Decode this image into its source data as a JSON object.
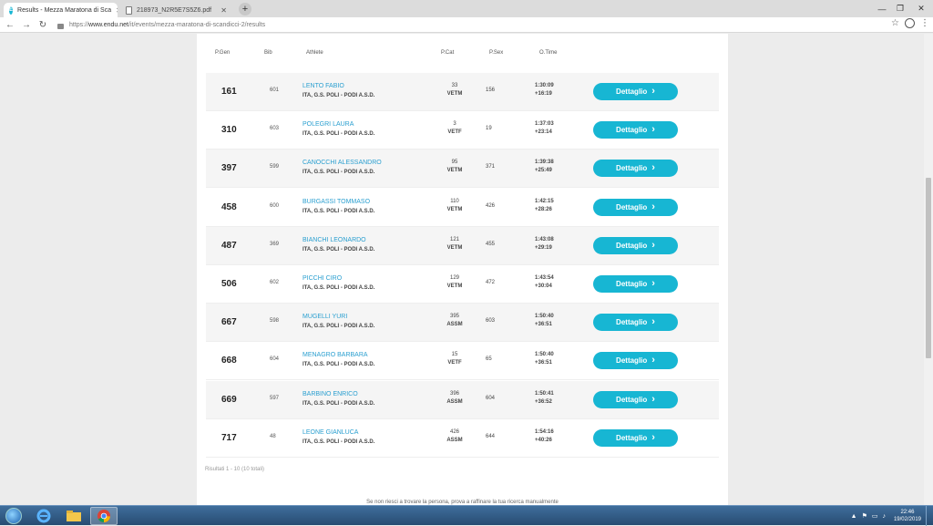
{
  "browser": {
    "tabs": [
      {
        "title": "Results - Mezza Maratona di Sca",
        "favicon": "E",
        "active": true
      },
      {
        "title": "218973_N2R5E7S5Z6.pdf",
        "active": false
      }
    ],
    "new_tab_glyph": "+",
    "address": {
      "scheme": "https://",
      "domain": "www.endu.net",
      "path": "/it/events/mezza-maratona-di-scandicci-2/results"
    }
  },
  "table": {
    "headers": {
      "pgen": "P.Gen",
      "bib": "Bib",
      "athlete": "Athlete",
      "pcat": "P.Cat",
      "psex": "P.Sex",
      "otime": "O.Time"
    },
    "detail_label": "Dettaglio",
    "rows": [
      {
        "pgen": "161",
        "bib": "601",
        "name": "LENTO FABIO",
        "club": "ITA, G.S. POLI - PODI A.S.D.",
        "pcat": "33",
        "cat": "VETM",
        "psex": "156",
        "time": "1:30:09",
        "gap": "+16:19"
      },
      {
        "pgen": "310",
        "bib": "603",
        "name": "POLEGRI LAURA",
        "club": "ITA, G.S. POLI - PODI A.S.D.",
        "pcat": "3",
        "cat": "VETF",
        "psex": "19",
        "time": "1:37:03",
        "gap": "+23:14"
      },
      {
        "pgen": "397",
        "bib": "599",
        "name": "CANOCCHI ALESSANDRO",
        "club": "ITA, G.S. POLI - PODI A.S.D.",
        "pcat": "95",
        "cat": "VETM",
        "psex": "371",
        "time": "1:39:38",
        "gap": "+25:49"
      },
      {
        "pgen": "458",
        "bib": "600",
        "name": "BURGASSI TOMMASO",
        "club": "ITA, G.S. POLI - PODI A.S.D.",
        "pcat": "110",
        "cat": "VETM",
        "psex": "426",
        "time": "1:42:15",
        "gap": "+28:26"
      },
      {
        "pgen": "487",
        "bib": "369",
        "name": "BIANCHI LEONARDO",
        "club": "ITA, G.S. POLI - PODI A.S.D.",
        "pcat": "121",
        "cat": "VETM",
        "psex": "455",
        "time": "1:43:08",
        "gap": "+29:19"
      },
      {
        "pgen": "506",
        "bib": "602",
        "name": "PICCHI CIRO",
        "club": "ITA, G.S. POLI - PODI A.S.D.",
        "pcat": "129",
        "cat": "VETM",
        "psex": "472",
        "time": "1:43:54",
        "gap": "+30:04"
      },
      {
        "pgen": "667",
        "bib": "598",
        "name": "MUGELLI YURI",
        "club": "ITA, G.S. POLI - PODI A.S.D.",
        "pcat": "395",
        "cat": "ASSM",
        "psex": "603",
        "time": "1:50:40",
        "gap": "+36:51"
      },
      {
        "pgen": "668",
        "bib": "604",
        "name": "MENAGRO BARBARA",
        "club": "ITA, G.S. POLI - PODI A.S.D.",
        "pcat": "15",
        "cat": "VETF",
        "psex": "65",
        "time": "1:50:40",
        "gap": "+36:51"
      },
      {
        "pgen": "669",
        "bib": "597",
        "name": "BARBINO ENRICO",
        "club": "ITA, G.S. POLI - PODI A.S.D.",
        "pcat": "396",
        "cat": "ASSM",
        "psex": "604",
        "time": "1:50:41",
        "gap": "+36:52"
      },
      {
        "pgen": "717",
        "bib": "48",
        "name": "LEONE GIANLUCA",
        "club": "ITA, G.S. POLI - PODI A.S.D.",
        "pcat": "426",
        "cat": "ASSM",
        "psex": "644",
        "time": "1:54:16",
        "gap": "+40:26"
      }
    ],
    "results_count": "Risultati 1 - 10 (10 totali)",
    "footer_hint": "Se non riesci a trovare la persona, prova a raffinare la tua ricerca manualmente"
  },
  "colors": {
    "accent": "#17b6d3",
    "athlete_link": "#2a9fd0"
  },
  "taskbar": {
    "apps": [
      "ie-icon",
      "folder-icon",
      "chrome-icon"
    ],
    "time": "22:46",
    "date": "19/02/2019"
  }
}
